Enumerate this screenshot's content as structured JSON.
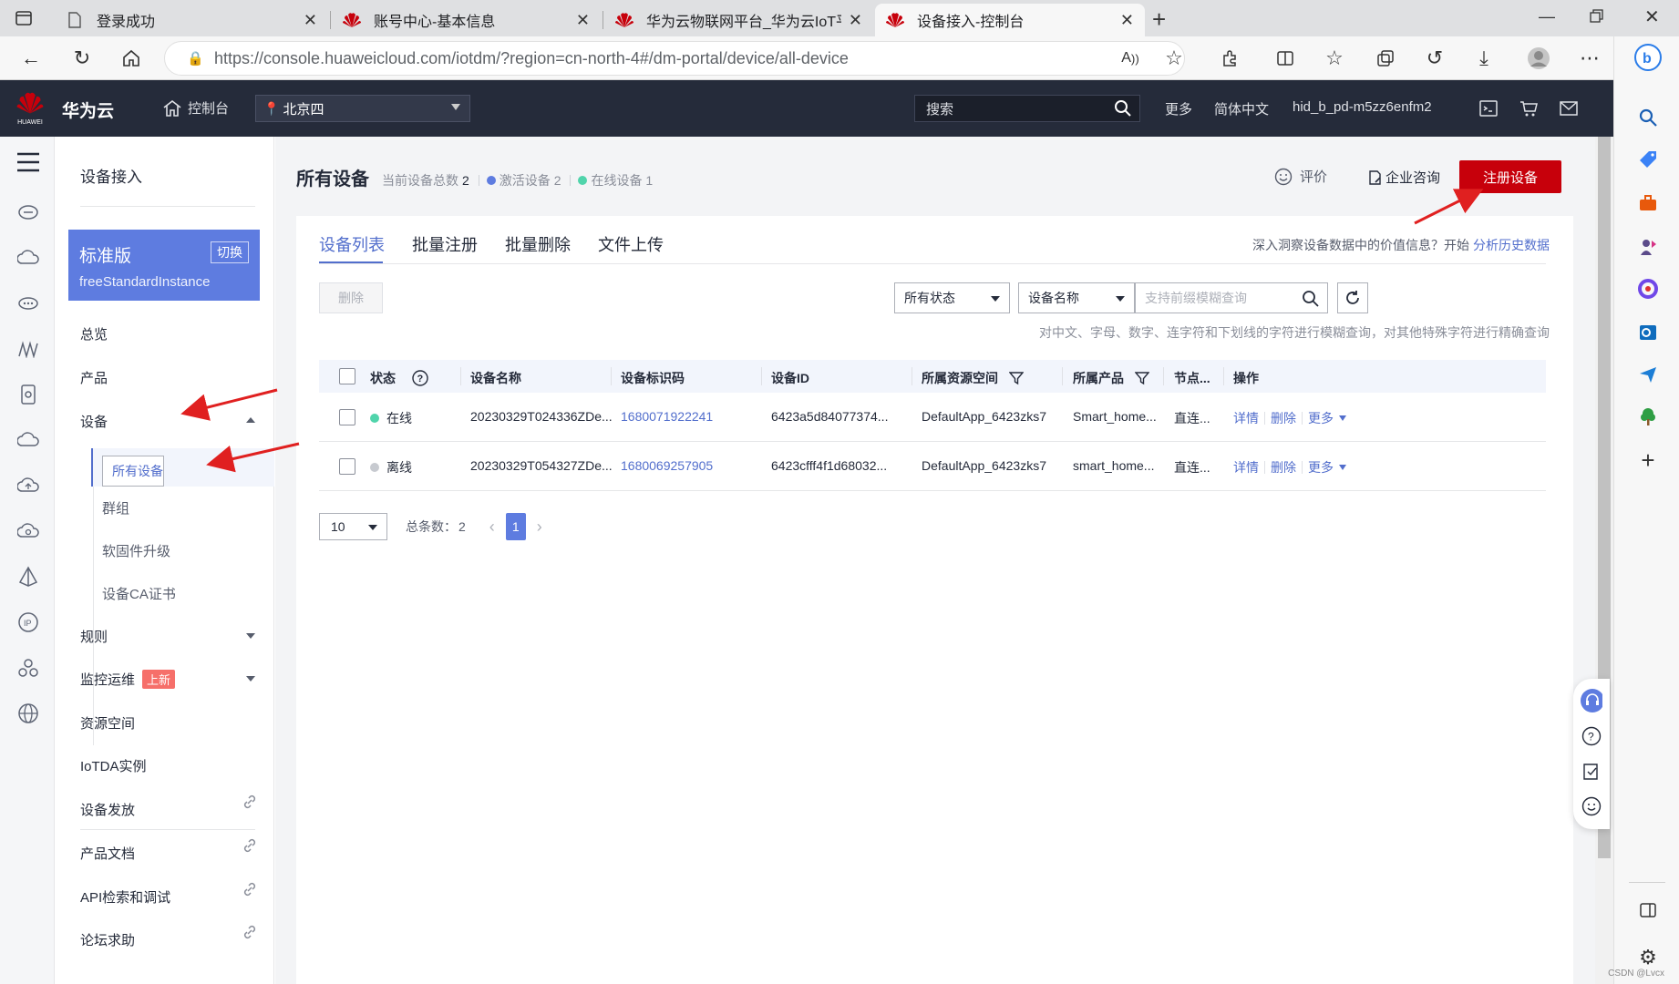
{
  "browser": {
    "tabs": [
      {
        "title": "登录成功",
        "favicon": "page-icon"
      },
      {
        "title": "账号中心-基本信息",
        "favicon": "huawei-logo"
      },
      {
        "title": "华为云物联网平台_华为云IoT平台",
        "favicon": "huawei-logo"
      },
      {
        "title": "设备接入-控制台",
        "favicon": "huawei-logo",
        "active": true
      }
    ],
    "url": "https://console.huaweicloud.com/iotdm/?region=cn-north-4#/dm-portal/device/all-device"
  },
  "header": {
    "brand": "华为云",
    "logo_text": "HUAWEI",
    "console": "控制台",
    "region": "北京四",
    "search_placeholder": "搜索",
    "more": "更多",
    "language": "简体中文",
    "account": "hid_b_pd-m5zz6enfm2"
  },
  "sidebar": {
    "title": "设备接入",
    "edition": {
      "name": "标准版",
      "switch": "切换",
      "instance": "freeStandardInstance"
    },
    "items": {
      "overview": "总览",
      "product": "产品",
      "device": "设备",
      "all_devices": "所有设备",
      "group": "群组",
      "firmware": "软固件升级",
      "ca_cert": "设备CA证书",
      "rules": "规则",
      "monitor": "监控运维",
      "monitor_badge": "上新",
      "resource_space": "资源空间",
      "iotda_instance": "IoTDA实例",
      "provisioning": "设备发放",
      "docs": "产品文档",
      "api": "API检索和调试",
      "forum": "论坛求助"
    }
  },
  "page": {
    "title": "所有设备",
    "total_label": "当前设备总数",
    "total": "2",
    "active_label": "激活设备",
    "active": "2",
    "online_label": "在线设备",
    "online": "1",
    "rate": "评价",
    "consult": "企业咨询",
    "register_button": "注册设备"
  },
  "tabs": [
    "设备列表",
    "批量注册",
    "批量删除",
    "文件上传"
  ],
  "insight": {
    "text": "深入洞察设备数据中的价值信息？开始",
    "link": "分析历史数据"
  },
  "toolbar": {
    "delete": "删除",
    "status_filter": "所有状态",
    "field_filter": "设备名称",
    "search_placeholder": "支持前缀模糊查询",
    "hint": "对中文、字母、数字、连字符和下划线的字符进行模糊查询，对其他特殊字符进行精确查询"
  },
  "table": {
    "columns": [
      "状态",
      "设备名称",
      "设备标识码",
      "设备ID",
      "所属资源空间",
      "所属产品",
      "节点...",
      "操作"
    ],
    "rows": [
      {
        "status": "在线",
        "status_color": "#50d4ab",
        "name": "20230329T024336ZDe...",
        "node_id": "1680071922241",
        "device_id": "6423a5d84077374...",
        "space": "DefaultApp_6423zks7",
        "product": "Smart_home...",
        "node_type": "直连...",
        "ops": [
          "详情",
          "删除",
          "更多"
        ]
      },
      {
        "status": "离线",
        "status_color": "#c7cad0",
        "name": "20230329T054327ZDe...",
        "node_id": "1680069257905",
        "device_id": "6423cfff4f1d68032...",
        "space": "DefaultApp_6423zks7",
        "product": "smart_home...",
        "node_type": "直连...",
        "ops": [
          "详情",
          "删除",
          "更多"
        ]
      }
    ]
  },
  "pagination": {
    "page_size": "10",
    "total_label": "总条数：",
    "total": "2",
    "current": "1"
  },
  "watermark": "CSDN @Lvcx",
  "colors": {
    "accent": "#526ecc",
    "brand_red": "#c7000b",
    "header_bg": "#252b3a",
    "edition_bg": "#5e7ce0",
    "active_dot": "#5e7ce0",
    "online_dot": "#50d4ab"
  }
}
